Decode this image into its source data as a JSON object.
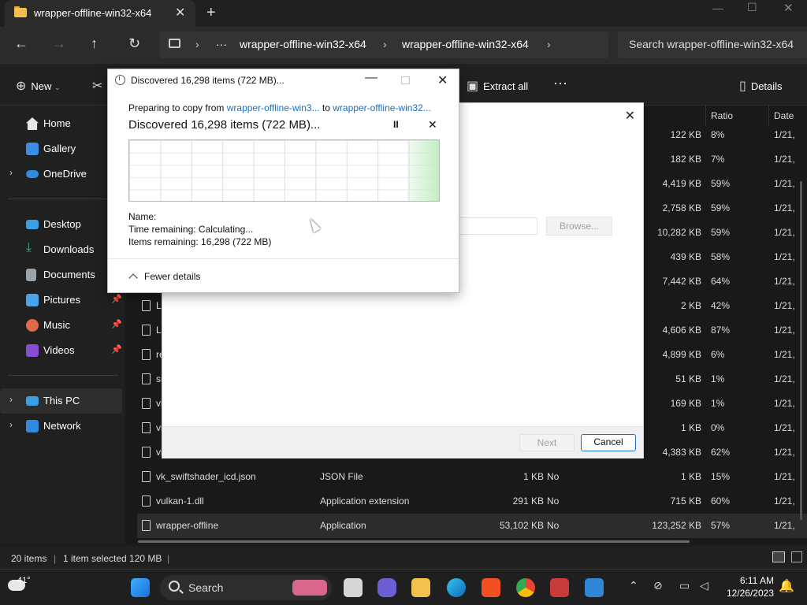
{
  "window": {
    "tab_title": "wrapper-offline-win32-x64",
    "new_tab": "+",
    "close_tab": "✕"
  },
  "address": {
    "segments": [
      "wrapper-offline-win32-x64",
      "wrapper-offline-win32-x64"
    ],
    "ellipsis": "···",
    "search_placeholder": "Search wrapper-offline-win32-x64"
  },
  "toolbar": {
    "new_label": "New",
    "extract_all": "Extract all",
    "more": "···",
    "details": "Details"
  },
  "sidebar": {
    "items": [
      {
        "label": "Home",
        "icon": "home-icon"
      },
      {
        "label": "Gallery",
        "icon": "gallery-icon"
      },
      {
        "label": "OneDrive",
        "icon": "cloud-icon"
      },
      {
        "label": "Desktop",
        "icon": "desktop-icon"
      },
      {
        "label": "Downloads",
        "icon": "download-icon"
      },
      {
        "label": "Documents",
        "icon": "documents-icon"
      },
      {
        "label": "Pictures",
        "icon": "pictures-icon"
      },
      {
        "label": "Music",
        "icon": "music-icon"
      },
      {
        "label": "Videos",
        "icon": "videos-icon"
      },
      {
        "label": "This PC",
        "icon": "pc-icon"
      },
      {
        "label": "Network",
        "icon": "network-icon"
      }
    ]
  },
  "columns": {
    "ratio": "Ratio",
    "date": "Date"
  },
  "rows": [
    {
      "name": "",
      "type": "",
      "packed": "",
      "protected": "",
      "size": "122 KB",
      "ratio": "8%",
      "date": "1/21,"
    },
    {
      "name": "",
      "type": "",
      "packed": "",
      "protected": "",
      "size": "182 KB",
      "ratio": "7%",
      "date": "1/21,"
    },
    {
      "name": "",
      "type": "",
      "packed": "",
      "protected": "",
      "size": "4,419 KB",
      "ratio": "59%",
      "date": "1/21,"
    },
    {
      "name": "",
      "type": "",
      "packed": "",
      "protected": "",
      "size": "2,758 KB",
      "ratio": "59%",
      "date": "1/21,"
    },
    {
      "name": "",
      "type": "",
      "packed": "",
      "protected": "",
      "size": "10,282 KB",
      "ratio": "59%",
      "date": "1/21,"
    },
    {
      "name": "",
      "type": "",
      "packed": "",
      "protected": "",
      "size": "439 KB",
      "ratio": "58%",
      "date": "1/21,"
    },
    {
      "name": "",
      "type": "",
      "packed": "",
      "protected": "",
      "size": "7,442 KB",
      "ratio": "64%",
      "date": "1/21,"
    },
    {
      "name": "L",
      "type": "",
      "packed": "",
      "protected": "",
      "size": "2 KB",
      "ratio": "42%",
      "date": "1/21,"
    },
    {
      "name": "L",
      "type": "",
      "packed": "",
      "protected": "",
      "size": "4,606 KB",
      "ratio": "87%",
      "date": "1/21,"
    },
    {
      "name": "re",
      "type": "",
      "packed": "",
      "protected": "",
      "size": "4,899 KB",
      "ratio": "6%",
      "date": "1/21,"
    },
    {
      "name": "sr",
      "type": "",
      "packed": "",
      "protected": "",
      "size": "51 KB",
      "ratio": "1%",
      "date": "1/21,"
    },
    {
      "name": "vi",
      "type": "",
      "packed": "",
      "protected": "",
      "size": "169 KB",
      "ratio": "1%",
      "date": "1/21,"
    },
    {
      "name": "vi",
      "type": "",
      "packed": "",
      "protected": "",
      "size": "1 KB",
      "ratio": "0%",
      "date": "1/21,"
    },
    {
      "name": "vi",
      "type": "",
      "packed": "",
      "protected": "",
      "size": "4,383 KB",
      "ratio": "62%",
      "date": "1/21,"
    },
    {
      "name": "vk_swiftshader_icd.json",
      "type": "JSON File",
      "packed": "1 KB",
      "protected": "No",
      "size": "1 KB",
      "ratio": "15%",
      "date": "1/21,"
    },
    {
      "name": "vulkan-1.dll",
      "type": "Application extension",
      "packed": "291 KB",
      "protected": "No",
      "size": "715 KB",
      "ratio": "60%",
      "date": "1/21,"
    },
    {
      "name": "wrapper-offline",
      "type": "Application",
      "packed": "53,102 KB",
      "protected": "No",
      "size": "123,252 KB",
      "ratio": "57%",
      "date": "1/21,"
    }
  ],
  "status": {
    "count": "20 items",
    "selected": "1 item selected  120 MB"
  },
  "wizard": {
    "browse": "Browse...",
    "next": "Next",
    "cancel": "Cancel",
    "close": "✕"
  },
  "copy_dialog": {
    "title": "Discovered 16,298 items (722 MB)...",
    "prep_prefix": "Preparing to copy from ",
    "from": "wrapper-offline-win3...",
    "to_word": " to ",
    "to": "wrapper-offline-win32...",
    "heading": "Discovered 16,298 items (722 MB)...",
    "pause": "II",
    "cancel": "✕",
    "name_label": "Name:",
    "time_remaining": "Time remaining:  Calculating...",
    "items_remaining": "Items remaining:  16,298 (722 MB)",
    "fewer_details": "Fewer details"
  },
  "taskbar": {
    "weather": "41°",
    "search": "Search",
    "time": "6:11 AM",
    "date": "12/26/2023"
  },
  "colors": {
    "accent": "#1a6fc4",
    "link": "#1f6fbf",
    "folder": "#f2c14e"
  }
}
